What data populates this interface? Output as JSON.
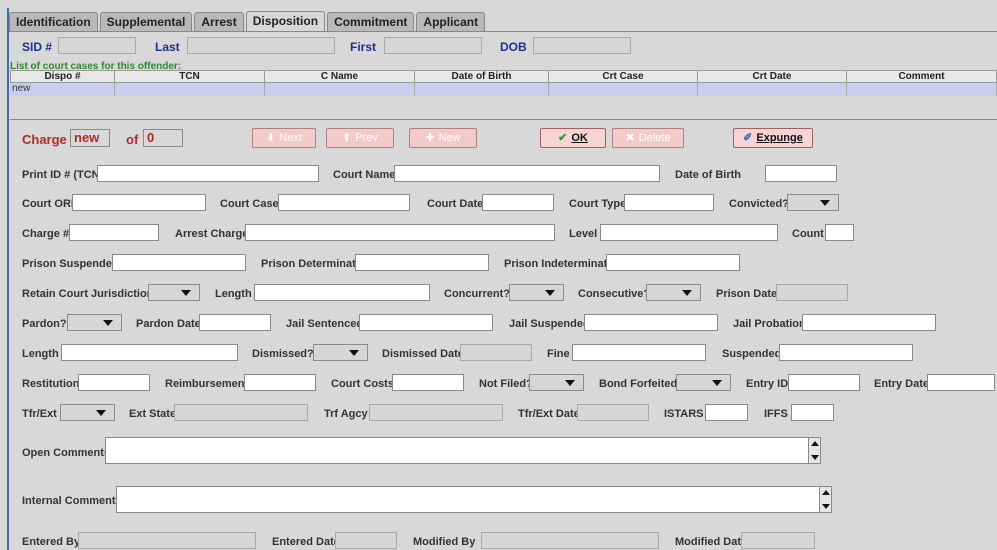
{
  "tabs": [
    "Identification",
    "Supplemental",
    "Arrest",
    "Disposition",
    "Commitment",
    "Applicant"
  ],
  "active_tab": "Disposition",
  "offender": {
    "sid_label": "SID #",
    "last_label": "Last",
    "first_label": "First",
    "dob_label": "DOB",
    "sid": "",
    "last": "",
    "first": "",
    "dob": ""
  },
  "list": {
    "title": "List of court cases for this offender:",
    "columns": [
      "Dispo #",
      "TCN",
      "C Name",
      "Date of Birth",
      "Crt Case",
      "Crt Date",
      "Comment"
    ],
    "rows": [
      [
        "new",
        "",
        "",
        "",
        "",
        "",
        ""
      ]
    ]
  },
  "charge": {
    "label": "Charge",
    "current": "new",
    "of_label": "of",
    "total": "0"
  },
  "buttons": {
    "next": "Next",
    "prev": "Prev",
    "new": "New",
    "ok": "OK",
    "delete": "Delete",
    "expunge": "Expunge"
  },
  "fields": {
    "print_id": "Print ID # (TCN)",
    "court_name": "Court Name",
    "date_of_birth": "Date of Birth",
    "court_ori": "Court ORI",
    "court_case": "Court Case",
    "court_date": "Court Date",
    "court_type": "Court Type",
    "convicted": "Convicted?",
    "charge_no": "Charge #",
    "arrest_charge": "Arrest Charge",
    "level": "Level",
    "count": "Count",
    "prison_suspended": "Prison Suspended",
    "prison_determinate": "Prison Determinate",
    "prison_indeterminate": "Prison Indeterminate",
    "retain_court": "Retain Court Jurisdiction?",
    "length": "Length",
    "concurrent": "Concurrent?",
    "consecutive": "Consecutive?",
    "prison_date": "Prison Date",
    "pardon": "Pardon?",
    "pardon_date": "Pardon Date",
    "jail_sentenced": "Jail Sentenced",
    "jail_suspended": "Jail Suspended",
    "jail_probation": "Jail Probation",
    "length2": "Length",
    "dismissed": "Dismissed?",
    "dismissed_date": "Dismissed Date",
    "fine": "Fine",
    "suspended": "Suspended",
    "restitution": "Restitution",
    "reimbursement": "Reimbursement",
    "court_costs": "Court Costs",
    "not_filed": "Not Filed?",
    "bond_forfeited": "Bond Forfeited?",
    "entry_id": "Entry ID",
    "entry_date": "Entry Date",
    "tfr_ext": "Tfr/Ext",
    "ext_state": "Ext State",
    "trf_agcy": "Trf Agcy",
    "tfr_ext_date": "Tfr/Ext Date",
    "istars": "ISTARS",
    "iffs": "IFFS",
    "open_comments": "Open Comments",
    "internal_comments": "Internal Comments",
    "entered_by": "Entered By",
    "entered_date": "Entered Date",
    "modified_by": "Modified By",
    "modified_date": "Modified Date"
  },
  "colors": {
    "tab_border": "#888888",
    "grid_row": "#ccccee",
    "accent_red": "#b22a2a",
    "header_blue": "#1f2f8a",
    "list_green": "#2f8a2f"
  }
}
